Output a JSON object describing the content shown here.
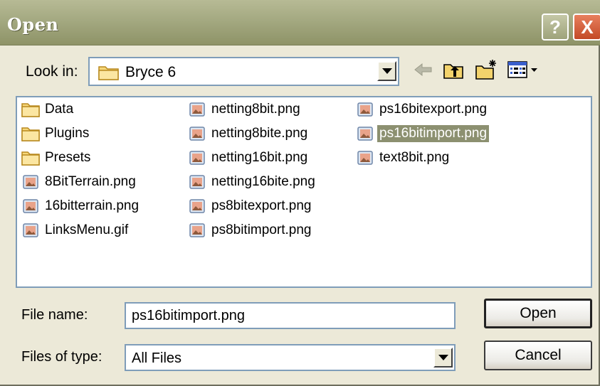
{
  "window": {
    "title": "Open",
    "help_glyph": "?",
    "close_glyph": "X"
  },
  "lookin": {
    "label": "Look in:",
    "value": "Bryce 6"
  },
  "files": [
    {
      "name": "Data",
      "type": "folder",
      "selected": false
    },
    {
      "name": "Plugins",
      "type": "folder",
      "selected": false
    },
    {
      "name": "Presets",
      "type": "folder",
      "selected": false
    },
    {
      "name": "8BitTerrain.png",
      "type": "image",
      "selected": false
    },
    {
      "name": "16bitterrain.png",
      "type": "image",
      "selected": false
    },
    {
      "name": "LinksMenu.gif",
      "type": "image",
      "selected": false
    },
    {
      "name": "netting8bit.png",
      "type": "image",
      "selected": false
    },
    {
      "name": "netting8bite.png",
      "type": "image",
      "selected": false
    },
    {
      "name": "netting16bit.png",
      "type": "image",
      "selected": false
    },
    {
      "name": "netting16bite.png",
      "type": "image",
      "selected": false
    },
    {
      "name": "ps8bitexport.png",
      "type": "image",
      "selected": false
    },
    {
      "name": "ps8bitimport.png",
      "type": "image",
      "selected": false
    },
    {
      "name": "ps16bitexport.png",
      "type": "image",
      "selected": false
    },
    {
      "name": "ps16bitimport.png",
      "type": "image",
      "selected": true
    },
    {
      "name": "text8bit.png",
      "type": "image",
      "selected": false
    }
  ],
  "filename": {
    "label": "File name:",
    "value": "ps16bitimport.png"
  },
  "filetype": {
    "label": "Files of type:",
    "value": "All Files"
  },
  "buttons": {
    "open": "Open",
    "cancel": "Cancel"
  },
  "colors": {
    "titlebar": "#a4a981",
    "selection": "#8c9070",
    "close": "#c34a27"
  }
}
